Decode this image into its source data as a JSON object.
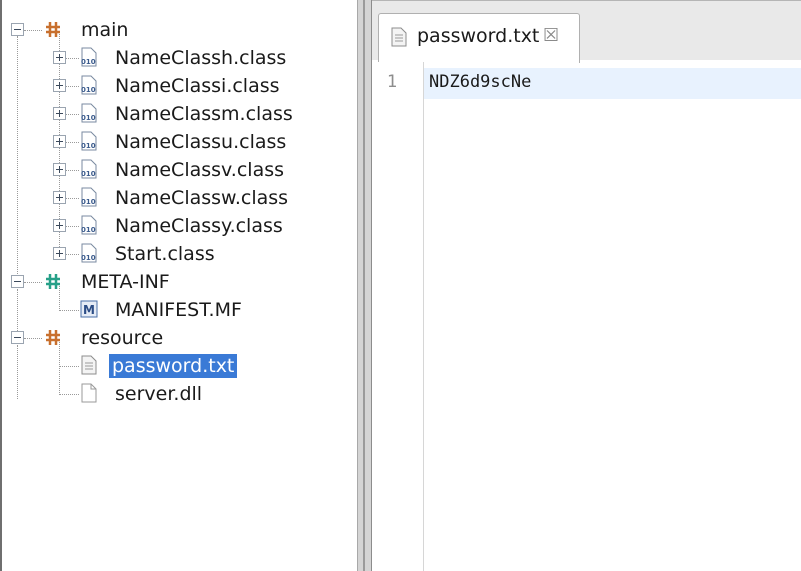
{
  "tree": {
    "items": [
      {
        "label": "main",
        "type": "package",
        "expanded": true
      },
      {
        "label": "NameClassh.class",
        "type": "class"
      },
      {
        "label": "NameClassi.class",
        "type": "class"
      },
      {
        "label": "NameClassm.class",
        "type": "class"
      },
      {
        "label": "NameClassu.class",
        "type": "class"
      },
      {
        "label": "NameClassv.class",
        "type": "class"
      },
      {
        "label": "NameClassw.class",
        "type": "class"
      },
      {
        "label": "NameClassy.class",
        "type": "class"
      },
      {
        "label": "Start.class",
        "type": "class"
      },
      {
        "label": "META-INF",
        "type": "package",
        "expanded": true
      },
      {
        "label": "MANIFEST.MF",
        "type": "manifest"
      },
      {
        "label": "resource",
        "type": "package",
        "expanded": true
      },
      {
        "label": "password.txt",
        "type": "text-file",
        "selected": true
      },
      {
        "label": "server.dll",
        "type": "file"
      }
    ]
  },
  "editor": {
    "tab": {
      "label": "password.txt",
      "close_icon": "close-tab-icon"
    },
    "lines": [
      {
        "number": "1",
        "text": "NDZ6d9scNe"
      }
    ]
  },
  "colors": {
    "selection": "#3a7ad6",
    "package_icon": "#c8702e",
    "current_line": "#e8f2fe"
  }
}
